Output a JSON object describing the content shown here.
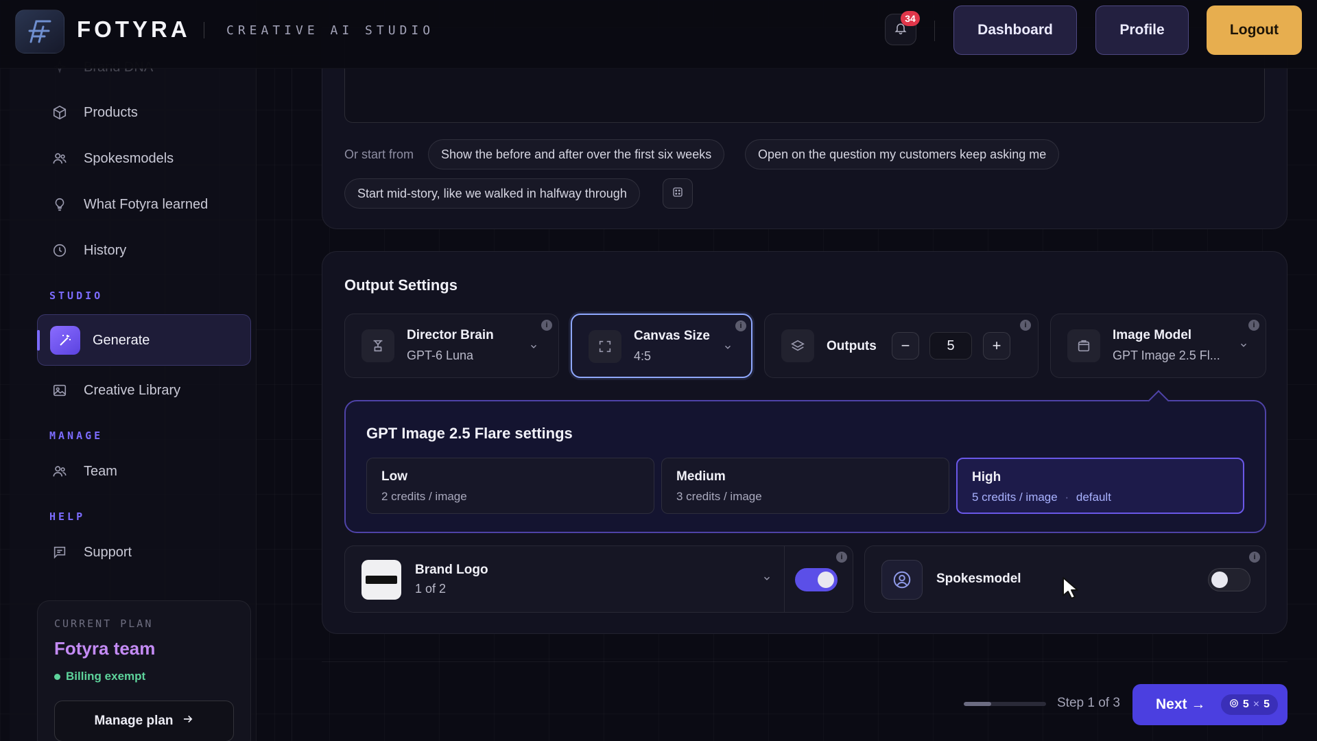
{
  "header": {
    "brand_name": "FOTYRA",
    "brand_tagline": "CREATIVE AI STUDIO",
    "notification_count": "34",
    "dashboard_label": "Dashboard",
    "profile_label": "Profile",
    "logout_label": "Logout"
  },
  "sidebar": {
    "faded_item": "Brand DNA",
    "items": [
      {
        "label": "Products",
        "icon": "box-icon"
      },
      {
        "label": "Spokesmodels",
        "icon": "users-icon"
      },
      {
        "label": "What Fotyra learned",
        "icon": "lightbulb-icon"
      },
      {
        "label": "History",
        "icon": "clock-icon"
      }
    ],
    "studio_label": "STUDIO",
    "generate_label": "Generate",
    "creative_library_label": "Creative Library",
    "manage_label": "MANAGE",
    "team_label": "Team",
    "help_label": "HELP",
    "support_label": "Support",
    "plan": {
      "label": "CURRENT PLAN",
      "name": "Fotyra team",
      "status": "Billing exempt",
      "manage_button": "Manage plan"
    }
  },
  "prompt": {
    "start_label": "Or start from",
    "chips": [
      "Show the before and after over the first six weeks",
      "Open on the question my customers keep asking me",
      "Start mid-story, like we walked in halfway through"
    ]
  },
  "output_settings": {
    "title": "Output Settings",
    "director_brain": {
      "title": "Director Brain",
      "value": "GPT-6 Luna"
    },
    "canvas_size": {
      "title": "Canvas Size",
      "value": "4:5"
    },
    "outputs": {
      "title": "Outputs",
      "value": "5",
      "minus": "−",
      "plus": "+"
    },
    "image_model": {
      "title": "Image Model",
      "value": "GPT Image 2.5 Fl..."
    },
    "flare": {
      "title": "GPT Image 2.5 Flare settings",
      "options": [
        {
          "name": "Low",
          "credits": "2 credits / image"
        },
        {
          "name": "Medium",
          "credits": "3 credits / image"
        },
        {
          "name": "High",
          "credits": "5 credits / image",
          "separator": "·",
          "tag": "default"
        }
      ]
    },
    "brand_logo": {
      "title": "Brand Logo",
      "value": "1 of 2",
      "enabled": true
    },
    "spokesmodel": {
      "title": "Spokesmodel",
      "enabled": false
    }
  },
  "footer": {
    "step_text": "Step 1 of 3",
    "progress_fraction": 0.33,
    "next_label": "Next →",
    "next_count_a": "5",
    "next_times": "×",
    "next_count_b": "5"
  },
  "colors": {
    "accent": "#7c6cff",
    "logout": "#e7ae4f",
    "badge": "#e0364a",
    "plan_name": "#c48bf5",
    "status_green": "#5dd39b"
  }
}
